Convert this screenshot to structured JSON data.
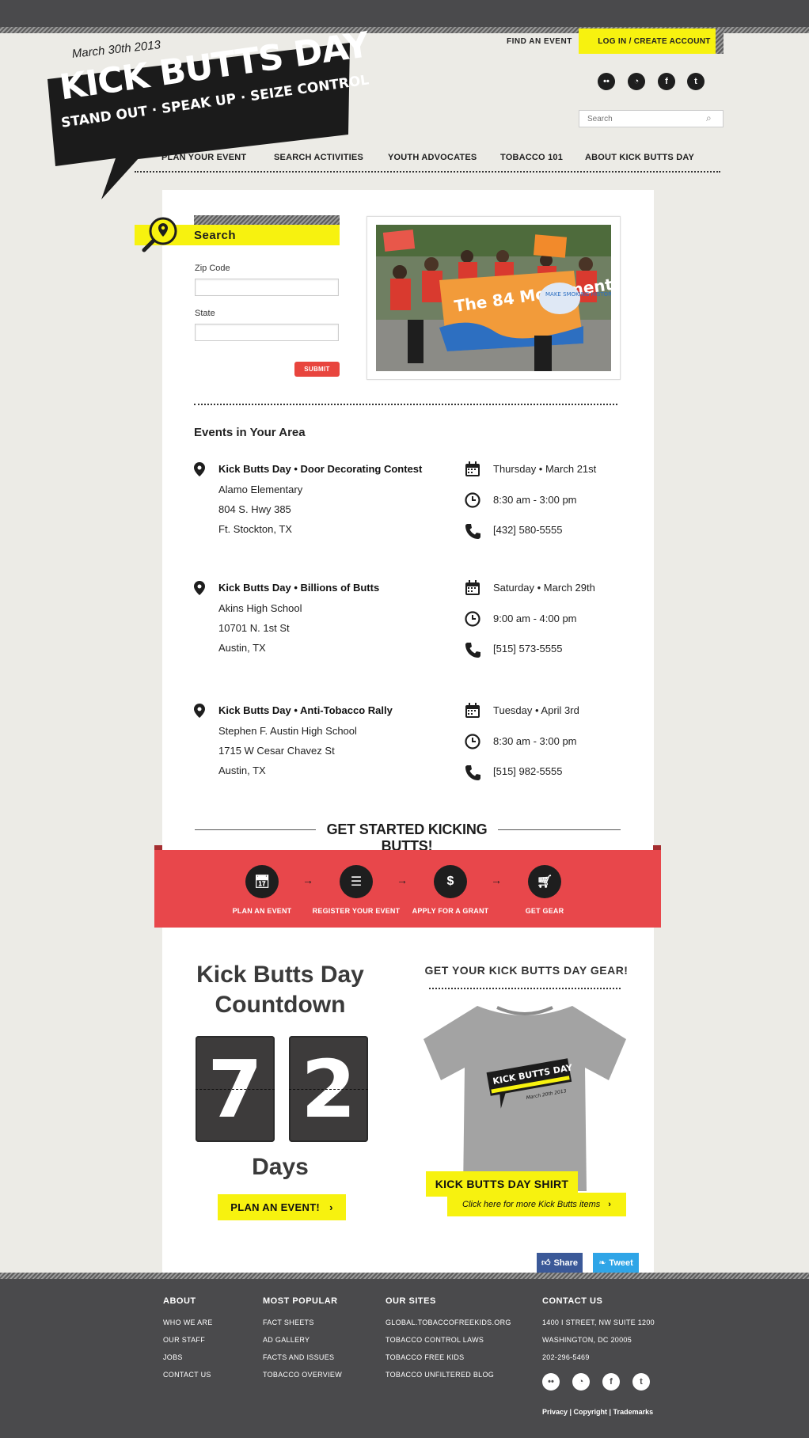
{
  "header": {
    "logo_date": "March 30th 2013",
    "logo_title": "KICK BUTTS DAY",
    "logo_tagline": "STAND OUT · SPEAK UP · SEIZE CONTROL",
    "find_event": "FIND AN EVENT",
    "login": "LOG IN / CREATE ACCOUNT",
    "social_icons": [
      "flickr-icon",
      "rss-icon",
      "facebook-icon",
      "twitter-icon"
    ],
    "search_placeholder": "Search"
  },
  "nav": {
    "items": [
      "PLAN YOUR EVENT",
      "SEARCH ACTIVITIES",
      "YOUTH ADVOCATES",
      "TOBACCO 101",
      "ABOUT KICK BUTTS DAY"
    ]
  },
  "search_panel": {
    "title": "Search",
    "zip_label": "Zip Code",
    "state_label": "State",
    "submit": "SUBMIT"
  },
  "photo": {
    "banner_text": "The 84 Movement",
    "sign_text": "MAKE SMOKING HISTORY"
  },
  "events": {
    "title": "Events in Your Area",
    "items": [
      {
        "name": "Kick Butts Day • Door Decorating Contest",
        "place": "Alamo Elementary",
        "street": "804 S. Hwy 385",
        "city": "Ft. Stockton, TX",
        "date": "Thursday • March 21st",
        "time": "8:30 am - 3:00 pm",
        "phone": "[432] 580-5555"
      },
      {
        "name": "Kick Butts Day • Billions of Butts",
        "place": "Akins High School",
        "street": "10701 N. 1st St",
        "city": "Austin, TX",
        "date": "Saturday • March 29th",
        "time": "9:00 am - 4:00 pm",
        "phone": "[515] 573-5555"
      },
      {
        "name": "Kick Butts Day • Anti-Tobacco Rally",
        "place": "Stephen F. Austin High School",
        "street": "1715 W Cesar Chavez St",
        "city": "Austin, TX",
        "date": "Tuesday • April 3rd",
        "time": "8:30 am - 3:00 pm",
        "phone": "[515] 982-5555"
      }
    ]
  },
  "get_started": {
    "title": "GET STARTED KICKING BUTTS!",
    "steps": [
      {
        "label": "PLAN AN EVENT",
        "icon": "calendar-icon"
      },
      {
        "label": "REGISTER YOUR EVENT",
        "icon": "clipboard-icon"
      },
      {
        "label": "APPLY FOR A GRANT",
        "icon": "dollar-icon"
      },
      {
        "label": "GET GEAR",
        "icon": "cart-icon"
      }
    ]
  },
  "countdown": {
    "title_line1": "Kick Butts Day",
    "title_line2": "Countdown",
    "digit1": "7",
    "digit2": "2",
    "unit": "Days",
    "button": "PLAN AN EVENT!"
  },
  "gear": {
    "title": "GET YOUR KICK BUTTS DAY GEAR!",
    "shirt_label": "KICK BUTTS DAY SHIRT",
    "more_link": "Click here for more Kick Butts items",
    "shirt_print_title": "KICK BUTTS DAY",
    "shirt_print_date": "March 20th 2013"
  },
  "share": {
    "share": "Share",
    "tweet": "Tweet"
  },
  "footer": {
    "about": {
      "title": "ABOUT",
      "links": [
        "WHO WE ARE",
        "OUR STAFF",
        "JOBS",
        "CONTACT US"
      ]
    },
    "popular": {
      "title": "MOST POPULAR",
      "links": [
        "FACT SHEETS",
        "AD GALLERY",
        "FACTS AND ISSUES",
        "TOBACCO OVERVIEW"
      ]
    },
    "sites": {
      "title": "OUR SITES",
      "links": [
        "GLOBAL.TOBACCOFREEKIDS.ORG",
        "TOBACCO CONTROL LAWS",
        "TOBACCO FREE KIDS",
        "TOBACCO UNFILTERED BLOG"
      ]
    },
    "contact": {
      "title": "CONTACT US",
      "lines": [
        "1400 I STREET, NW SUITE 1200",
        "WASHINGTON, DC 20005",
        "202-296-5469"
      ]
    },
    "legal": "Privacy | Copyright | Trademarks"
  },
  "colors": {
    "yellow": "#f7f20f",
    "red": "#e8474b",
    "dark": "#4a4a4c"
  }
}
